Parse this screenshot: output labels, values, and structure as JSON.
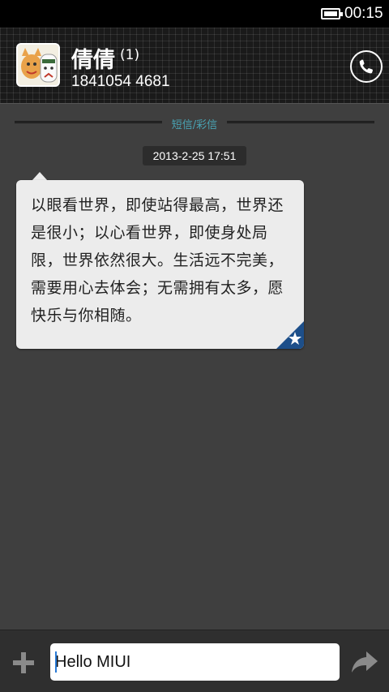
{
  "status_bar": {
    "time": "00:15"
  },
  "header": {
    "contact_name": "倩倩",
    "unread_count": "(1)",
    "phone_number": "1841054 4681"
  },
  "divider": {
    "label": "短信/彩信"
  },
  "conversation": {
    "timestamp": "2013-2-25 17:51",
    "message": "以眼看世界，即使站得最高，世界还是很小；以心看世界，即使身处局限，世界依然很大。生活远不完美，需要用心去体会；无需拥有太多，愿快乐与你相随。",
    "starred": true
  },
  "compose": {
    "input_value": "Hello MIUI"
  },
  "colors": {
    "accent": "#49a3b3",
    "star_badge": "#1d4f8a"
  }
}
